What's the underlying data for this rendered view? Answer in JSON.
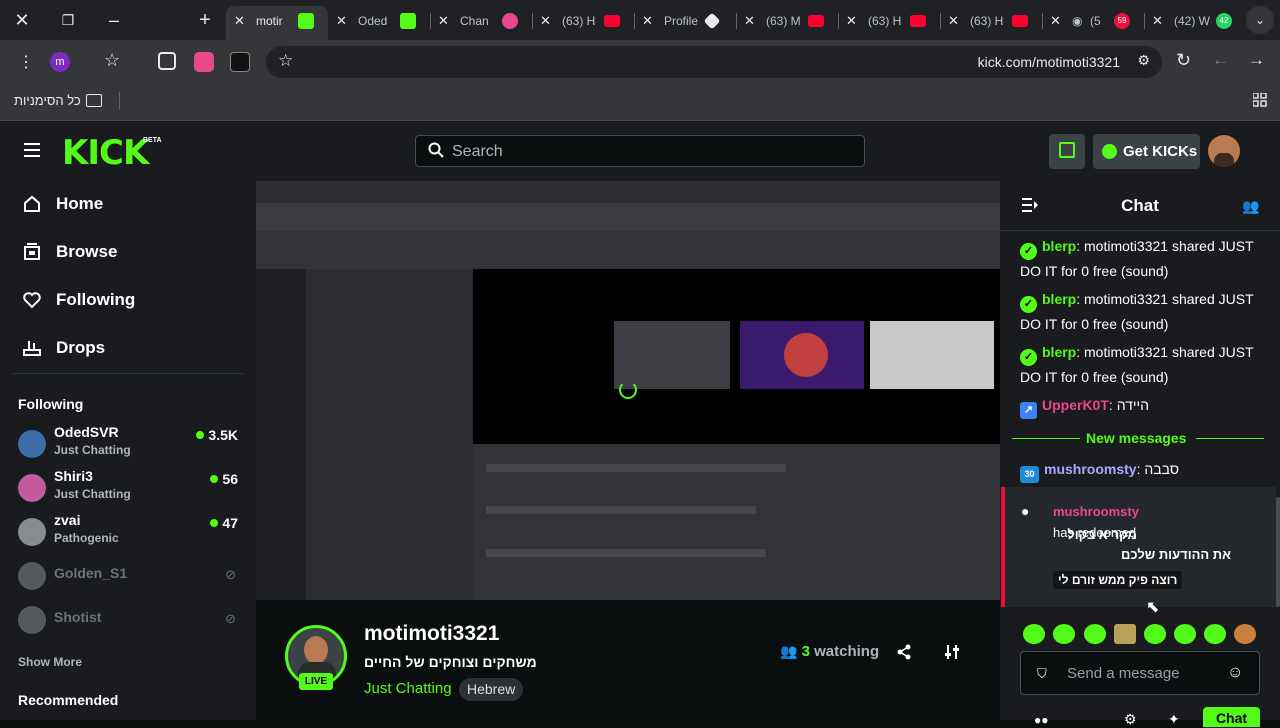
{
  "browser": {
    "tabs": [
      {
        "title": "motir",
        "favicon": "kick",
        "active": true
      },
      {
        "title": "Oded",
        "favicon": "kick"
      },
      {
        "title": "Chan",
        "favicon": "pink"
      },
      {
        "title": "(63) H",
        "favicon": "youtube"
      },
      {
        "title": "Profile",
        "favicon": "white"
      },
      {
        "title": "(63) M",
        "favicon": "youtube"
      },
      {
        "title": "(63) H",
        "favicon": "youtube"
      },
      {
        "title": "(63) H",
        "favicon": "youtube"
      },
      {
        "title": "(5",
        "favicon": "record",
        "badge": "59"
      },
      {
        "title": "(42) W",
        "favicon": "green",
        "badge": "42"
      }
    ],
    "url": "kick.com/motimoti3321",
    "bookmarks_folder": "כל הסימניות",
    "extension_m_label": "m"
  },
  "header": {
    "logo": "KICK",
    "logo_beta": "BETA",
    "search_placeholder": "Search",
    "get_kicks": "Get KICKs"
  },
  "sidebar": {
    "nav": [
      {
        "label": "Home",
        "icon": "home-icon"
      },
      {
        "label": "Browse",
        "icon": "browse-icon"
      },
      {
        "label": "Following",
        "icon": "heart-icon"
      },
      {
        "label": "Drops",
        "icon": "drops-icon"
      }
    ],
    "following_title": "Following",
    "following": [
      {
        "name": "OdedSVR",
        "category": "Just Chatting",
        "viewers": "3.5K",
        "online": true
      },
      {
        "name": "Shiri3",
        "category": "Just Chatting",
        "viewers": "56",
        "online": true
      },
      {
        "name": "zvai",
        "category": "Pathogenic",
        "viewers": "47",
        "online": true
      },
      {
        "name": "Golden_S1",
        "online": false
      },
      {
        "name": "Shotist",
        "online": false
      }
    ],
    "show_more": "Show More",
    "recommended_title": "Recommended"
  },
  "stream": {
    "username": "motimoti3321",
    "title": "משחקים וצוחקים של החיים",
    "category": "Just Chatting",
    "tag": "Hebrew",
    "live_label": "LIVE",
    "watching_count": "3",
    "watching_label": "watching"
  },
  "chat": {
    "title": "Chat",
    "messages": [
      {
        "user": "blerp",
        "text": "motimoti3321 shared JUST DO IT for 0 free (sound)",
        "color": "#53fc18"
      },
      {
        "user": "blerp",
        "text": "motimoti3321 shared JUST DO IT for 0 free (sound)",
        "color": "#53fc18"
      },
      {
        "user": "blerp",
        "text": "motimoti3321 shared JUST DO IT for 0 free (sound)",
        "color": "#53fc18"
      },
      {
        "user": "UpperK0T",
        "text": "היידה",
        "color": "#e9488d"
      }
    ],
    "new_messages_label": "New messages",
    "after_new": [
      {
        "user": "mushroomsty",
        "badge": "30",
        "text": "סבבה",
        "color": "#a8a8ff"
      }
    ],
    "redeem": {
      "user": "mushroomsty",
      "prefix": "has redeemed",
      "reward": "מקריא בקול את ההודעות שלכם",
      "message": "רוצה פיק ממש זורם לי"
    },
    "input_placeholder": "Send a message",
    "send_label": "Chat"
  },
  "colors": {
    "kick_green": "#53fc18",
    "live_red": "#e9113c"
  }
}
